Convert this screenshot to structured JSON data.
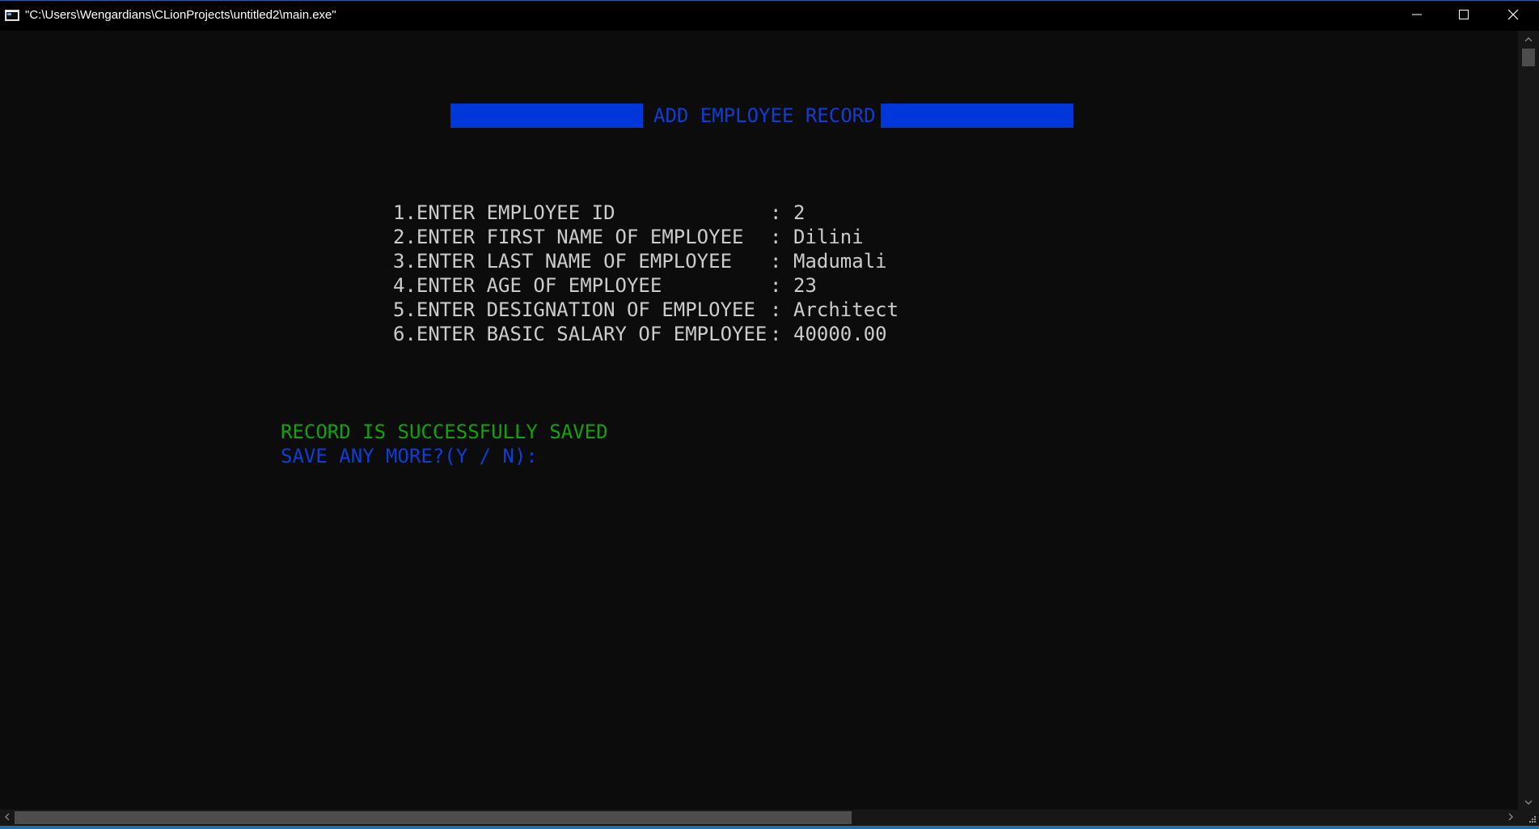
{
  "window": {
    "title": "\"C:\\Users\\Wengardians\\CLionProjects\\untitled2\\main.exe\""
  },
  "console": {
    "banner_title": "ADD EMPLOYEE RECORD",
    "form": [
      {
        "label": "1.ENTER EMPLOYEE ID",
        "value": "2"
      },
      {
        "label": "2.ENTER FIRST NAME OF EMPLOYEE",
        "value": "Dilini"
      },
      {
        "label": "3.ENTER LAST NAME OF EMPLOYEE",
        "value": "Madumali"
      },
      {
        "label": "4.ENTER AGE OF EMPLOYEE",
        "value": "23"
      },
      {
        "label": "5.ENTER DESIGNATION OF EMPLOYEE",
        "value": "Architect"
      },
      {
        "label": "6.ENTER BASIC SALARY OF EMPLOYEE",
        "value": "40000.00"
      }
    ],
    "separator": ":",
    "success_message": "RECORD IS SUCCESSFULLY SAVED",
    "prompt": "SAVE ANY MORE?(Y / N):"
  },
  "colors": {
    "background": "#0c0c0c",
    "text": "#cccccc",
    "banner_bar": "#0037da",
    "banner_text": "#0f3dd6",
    "success": "#13a10e",
    "prompt": "#0f3dd6"
  },
  "icons": {
    "app": "console-app-icon",
    "minimize": "minimize-icon",
    "maximize": "maximize-icon",
    "close": "close-icon"
  }
}
